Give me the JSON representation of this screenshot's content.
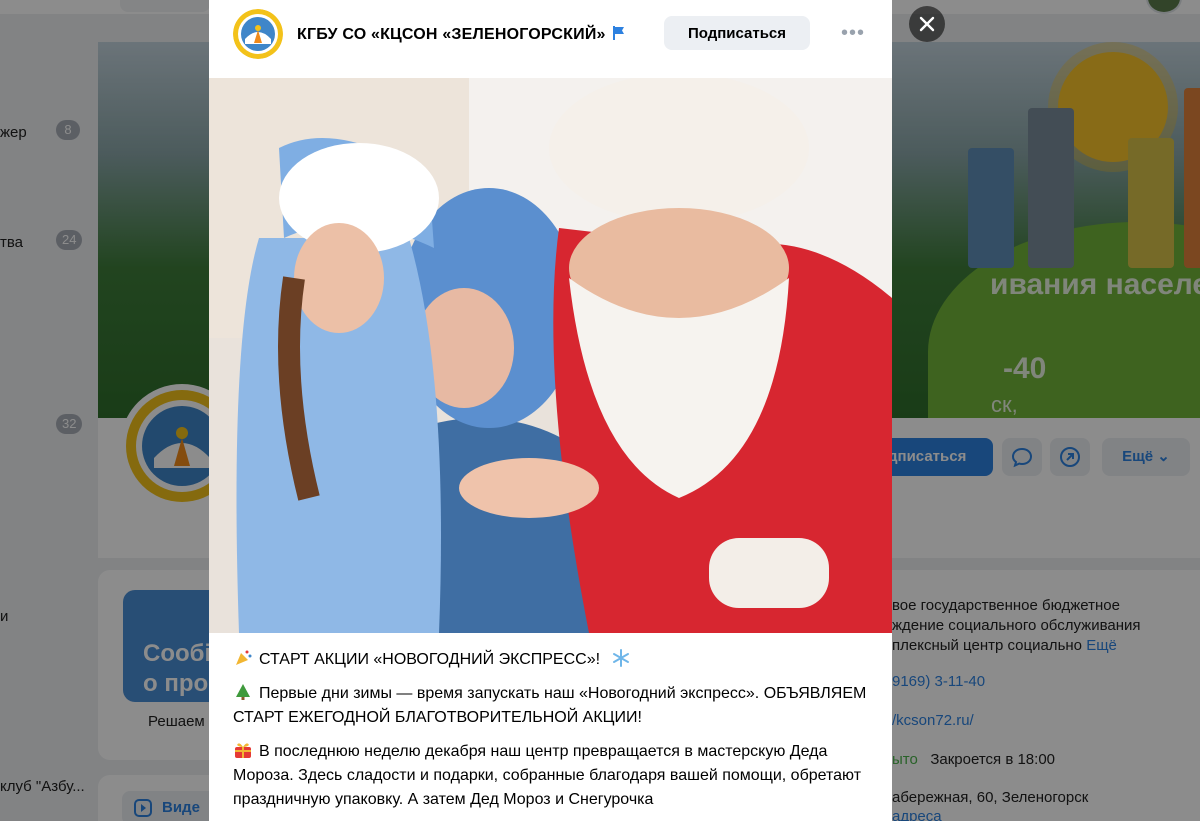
{
  "background": {
    "nav": [
      {
        "label": "жер",
        "count": "8"
      },
      {
        "label": "тва",
        "count": "24"
      },
      {
        "label": "",
        "count": "32"
      },
      {
        "label": "и",
        "count": ""
      },
      {
        "label": "клуб \"Азбу...",
        "count": ""
      }
    ],
    "cover": {
      "line1": "ивания населения",
      "line2": "-40",
      "line3": "ск,"
    },
    "actions": {
      "subscribe": "дписаться",
      "more": "Ещё"
    },
    "promo": {
      "line1": "Сообі",
      "line2": "о проб",
      "caption": "Решаем"
    },
    "video_label": "Виде",
    "info": {
      "desc1": "вое государственное бюджетное",
      "desc2": "ждение социального обслуживания",
      "desc3": "плексный центр социально",
      "desc_more": "Ещё",
      "phone": "9169) 3-11-40",
      "site": "/kcson72.ru/",
      "open_status": "ыто",
      "closes": "Закроется в 18:00",
      "address": "абережная, 60, Зеленогорск",
      "address2": "адреса"
    }
  },
  "modal": {
    "group_name": "КГБУ СО «КЦСОН «ЗЕЛЕНОГОРСКИЙ»",
    "subscribe_label": "Подписаться",
    "more_label": "•••",
    "post": {
      "p1": "СТАРТ АКЦИИ «НОВОГОДНИЙ ЭКСПРЕСС»!",
      "p2": "Первые дни зимы — время запускать наш «Новогодний экспресс». ОБЪЯВЛЯЕМ СТАРТ ЕЖЕГОДНОЙ БЛАГОТВОРИТЕЛЬНОЙ АКЦИИ!",
      "p3": "В последнюю неделю декабря наш центр превращается в мастерскую Деда Мороза. Здесь сладости и подарки, собранные благодаря вашей помощи, обретают праздничную упаковку. А затем Дед Мороз и Снегурочка"
    }
  },
  "colors": {
    "accent": "#2d81e0",
    "overlay": "rgba(0,0,0,0.45)"
  }
}
